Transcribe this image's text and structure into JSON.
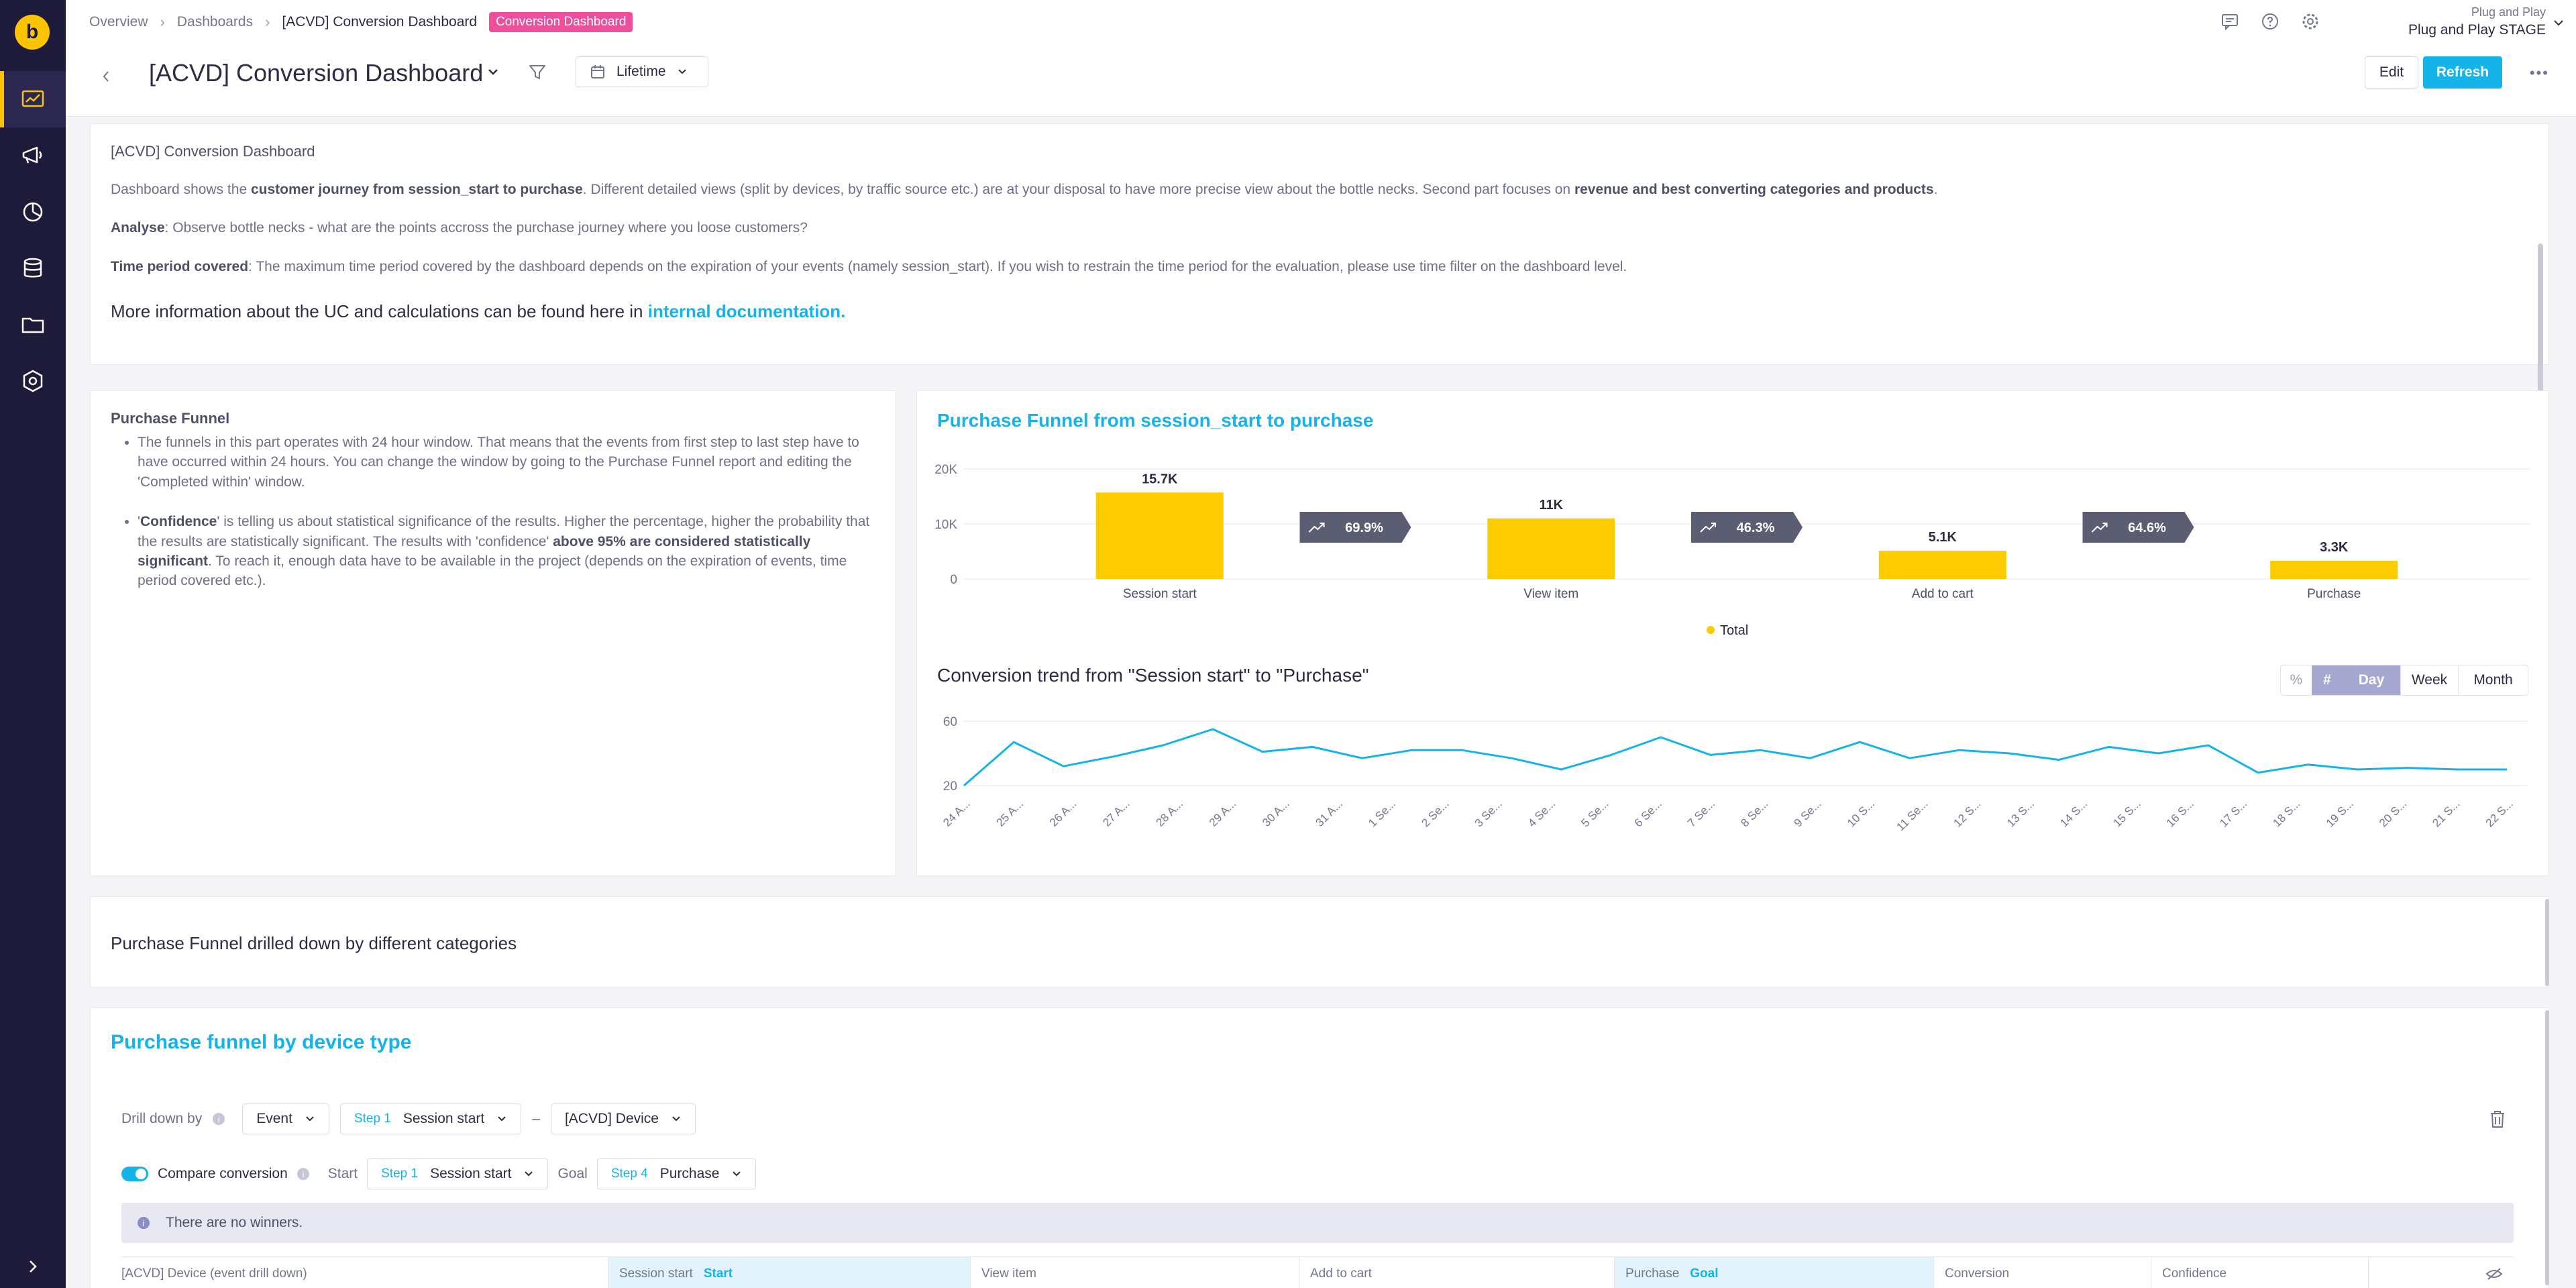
{
  "logo_letter": "b",
  "breadcrumb": {
    "items": [
      "Overview",
      "Dashboards",
      "[ACVD] Conversion Dashboard"
    ],
    "badge": "Conversion Dashboard"
  },
  "project": {
    "org": "Plug and Play",
    "name": "Plug and Play STAGE"
  },
  "dashboard": {
    "title": "[ACVD] Conversion Dashboard",
    "date_range": "Lifetime",
    "edit_label": "Edit",
    "refresh_label": "Refresh",
    "more_label": "•••"
  },
  "intro": {
    "heading": "[ACVD] Conversion Dashboard",
    "p1_a": "Dashboard shows the ",
    "p1_b": "customer journey from session_start to purchase",
    "p1_c": ". Different detailed views (split by devices, by traffic source etc.) are at your disposal to have more precise view about the bottle necks. Second part focuses on ",
    "p1_d": "revenue and best converting categories and products",
    "p1_e": ".",
    "p2_label": "Analyse",
    "p2_text": ": Observe bottle necks - what are the points accross the purchase journey where you loose customers?",
    "p3_label": "Time period covered",
    "p3_text": ": The maximum time period covered by the dashboard depends on the expiration of your events (namely session_start). If you wish to restrain the time period for the evaluation, please use time filter on the dashboard level.",
    "more_text": "More information about the UC and calculations can be found here in ",
    "more_link": "internal documentation."
  },
  "funnel_text": {
    "heading": "Purchase Funnel",
    "b1": "The funnels in this part operates with 24 hour window. That means that the events from first step to last step have to have occurred within 24 hours. You can change the window by going to the Purchase Funnel report and editing the 'Completed within' window.",
    "b2_a": "'",
    "b2_b": "Confidence",
    "b2_c": "' is telling us about statistical significance of the results. Higher the percentage, higher the probability that the results are statistically significant. The results with 'confidence' ",
    "b2_d": "above 95% are considered statistically significant",
    "b2_e": ". To reach it, enough data have to be available in the project (depends on the expiration of events, time period covered etc.)."
  },
  "funnel_chart_title": "Purchase Funnel from session_start to purchase",
  "trend_title": "Conversion trend from \"Session start\" to \"Purchase\"",
  "trend_controls": {
    "pct": "%",
    "num": "#",
    "day": "Day",
    "week": "Week",
    "month": "Month"
  },
  "chart_data": [
    {
      "type": "bar",
      "categories": [
        "Session start",
        "View item",
        "Add to cart",
        "Purchase"
      ],
      "values": [
        15700,
        11000,
        5100,
        3300
      ],
      "value_labels": [
        "15.7K",
        "11K",
        "5.1K",
        "3.3K"
      ],
      "step_conversions": [
        "69.9%",
        "46.3%",
        "64.6%"
      ],
      "y_ticks": [
        "20K",
        "10K",
        "0"
      ],
      "ylim": [
        0,
        20000
      ],
      "legend": [
        "Total"
      ],
      "color": "#fdcc00"
    },
    {
      "type": "line",
      "x": [
        "24 A...",
        "25 A...",
        "26 A...",
        "27 A...",
        "28 A...",
        "29 A...",
        "30 A...",
        "31 A...",
        "1 Se...",
        "2 Se...",
        "3 Se...",
        "4 Se...",
        "5 Se...",
        "6 Se...",
        "7 Se...",
        "8 Se...",
        "9 Se...",
        "10 S...",
        "11 Se...",
        "12 S...",
        "13 S...",
        "14 S...",
        "15 S...",
        "16 S...",
        "17 S...",
        "18 S...",
        "19 S...",
        "20 S...",
        "21 S...",
        "22 S..."
      ],
      "values": [
        20,
        47,
        32,
        38,
        45,
        55,
        41,
        44,
        37,
        42,
        42,
        37,
        30,
        39,
        50,
        39,
        42,
        37,
        47,
        37,
        42,
        40,
        36,
        44,
        40,
        45,
        28,
        33,
        30,
        31,
        30,
        30
      ],
      "y_ticks": [
        "60",
        "20"
      ],
      "ylim": [
        15,
        65
      ],
      "color": "#16b3ea"
    }
  ],
  "drill_section_title": "Purchase Funnel drilled down by different categories",
  "device": {
    "title": "Purchase funnel by device type",
    "drill_label": "Drill down by",
    "drill_event": "Event",
    "step1_tag": "Step 1",
    "step1_value": "Session start",
    "property": "[ACVD] Device",
    "compare_label": "Compare conversion",
    "start_label": "Start",
    "start_step_tag": "Step 1",
    "start_step_value": "Session start",
    "goal_label": "Goal",
    "goal_step_tag": "Step 4",
    "goal_step_value": "Purchase",
    "no_winners": "There are no winners.",
    "columns": [
      {
        "label": "[ACVD] Device (event drill down)"
      },
      {
        "label": "Session start",
        "tag": "Start"
      },
      {
        "label": "View item"
      },
      {
        "label": "Add to cart"
      },
      {
        "label": "Purchase",
        "tag": "Goal"
      },
      {
        "label": "Conversion"
      },
      {
        "label": "Confidence"
      }
    ]
  }
}
